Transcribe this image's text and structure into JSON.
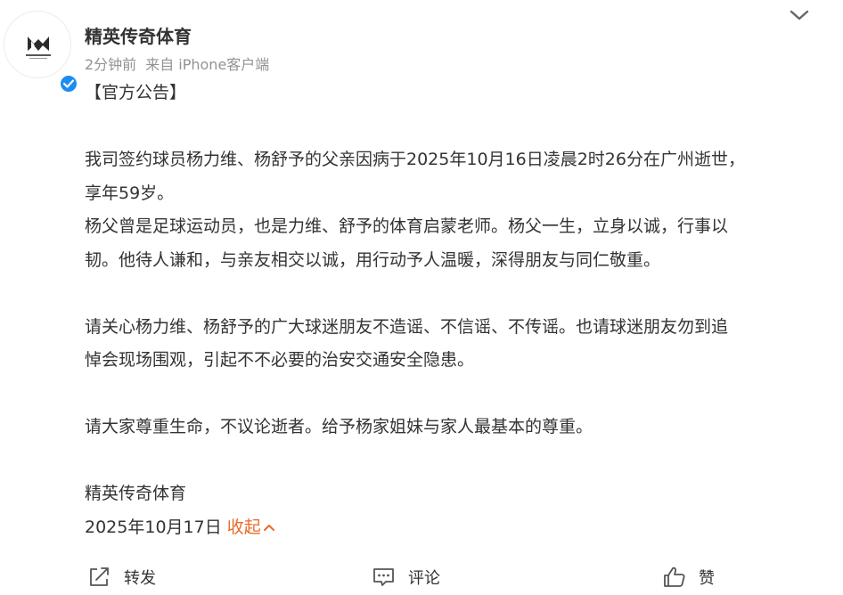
{
  "post": {
    "author": "精英传奇体育",
    "time": "2分钟前",
    "source": "来自 iPhone客户端",
    "lines": [
      "【官方公告】",
      "",
      "我司签约球员杨力维、杨舒予的父亲因病于2025年10月16日凌晨2时26分在广州逝世，",
      "享年59岁。",
      "杨父曾是足球运动员，也是力维、舒予的体育启蒙老师。杨父一生，立身以诚，行事以",
      "韧。他待人谦和，与亲友相交以诚，用行动予人温暖，深得朋友与同仁敬重。",
      "",
      "请关心杨力维、杨舒予的广大球迷朋友不造谣、不信谣、不传谣。也请球迷朋友勿到追",
      "悼会现场围观，引起不不必要的治安交通安全隐患。",
      "",
      "请大家尊重生命，不议论逝者。给予杨家姐妹与家人最基本的尊重。",
      "",
      "精英传奇体育"
    ],
    "date": "2025年10月17日",
    "collapse_label": "收起"
  },
  "actions": {
    "repost": "转发",
    "comment": "评论",
    "like": "赞"
  },
  "colors": {
    "accent": "#e86b28",
    "verified": "#1c8cf2",
    "meta": "#939393"
  }
}
